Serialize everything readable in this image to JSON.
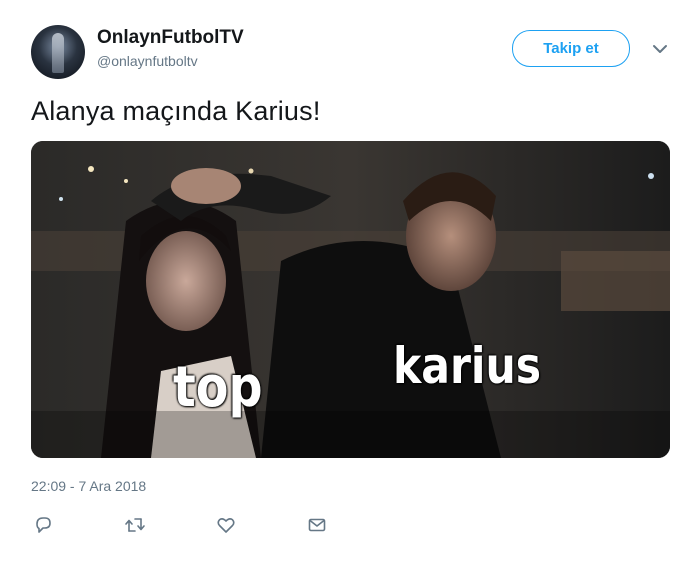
{
  "user": {
    "display_name": "OnlaynFutbolTV",
    "handle": "@onlaynfutboltv"
  },
  "follow_button_label": "Takip et",
  "tweet": {
    "text": "Alanya maçında Karius!",
    "timestamp": "22:09 - 7 Ara 2018"
  },
  "media": {
    "caption_left": "top",
    "caption_right": "karius"
  },
  "actions": [
    {
      "icon": "reply-icon"
    },
    {
      "icon": "retweet-icon"
    },
    {
      "icon": "like-icon"
    },
    {
      "icon": "message-icon"
    }
  ],
  "colors": {
    "accent": "#1da1f2",
    "secondary_text": "#657786",
    "primary_text": "#14171a"
  }
}
